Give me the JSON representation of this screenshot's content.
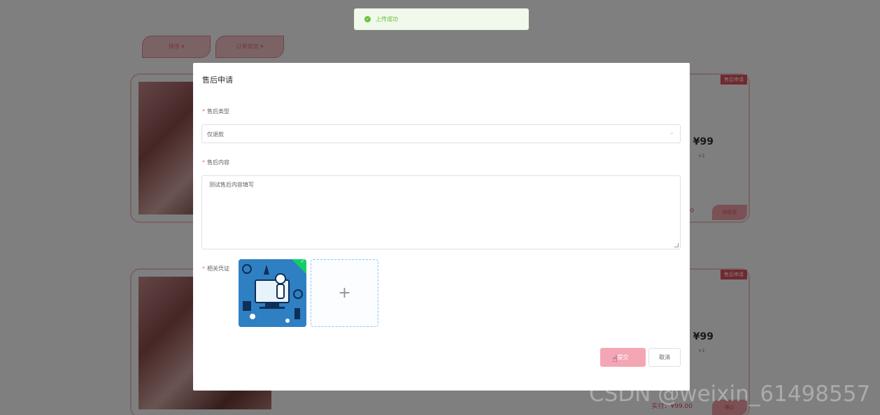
{
  "background": {
    "filters": [
      "排序",
      "订单状态"
    ],
    "orders": [
      {
        "tag": "售后申请",
        "price": "¥99",
        "qty": "×1",
        "partial": ".00",
        "action": "待收货"
      },
      {
        "tag": "售后申请",
        "price": "¥99",
        "qty": "×1",
        "paid": "实付：¥99.00",
        "action": "确认"
      }
    ]
  },
  "toast": {
    "icon": "success-check-icon",
    "text": "上传成功",
    "color": "#67c23a"
  },
  "dialog": {
    "title": "售后申请",
    "fields": {
      "type_label": "售后类型",
      "type_value": "仅退款",
      "content_label": "售后内容",
      "content_value": "测试售后内容填写",
      "evidence_label": "相关凭证"
    },
    "add_icon": "+",
    "submit_label": "提交",
    "cancel_label": "取消"
  },
  "colors": {
    "accent": "#f4a6b5",
    "required": "#f56c6c",
    "success": "#13ce66"
  },
  "watermark": "CSDN @weixin_61498557"
}
